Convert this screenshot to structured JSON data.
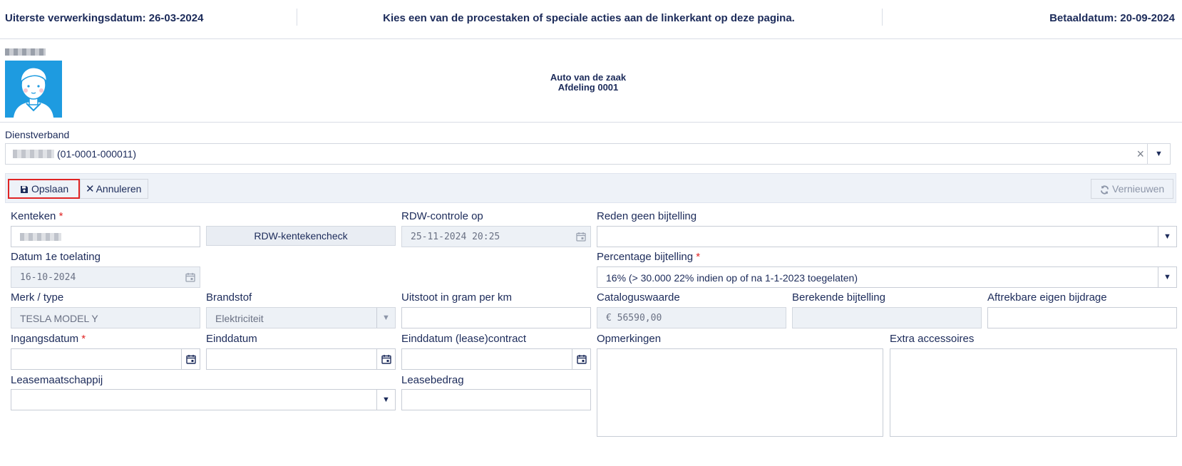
{
  "header": {
    "deadline": "Uiterste verwerkingsdatum: 26-03-2024",
    "instruction": "Kies een van de procestaken of speciale acties aan de linkerkant op deze pagina.",
    "paydate": "Betaaldatum: 20-09-2024"
  },
  "employee": {
    "title": "Auto van de zaak",
    "department": "Afdeling 0001"
  },
  "dienstverband": {
    "label": "Dienstverband",
    "value": "(01-0001-000011)"
  },
  "toolbar": {
    "save_label": "Opslaan",
    "cancel_label": "Annuleren",
    "refresh_label": "Vernieuwen"
  },
  "form": {
    "kenteken": {
      "label": "Kenteken",
      "required": "*"
    },
    "rdw_button": "RDW-kentekencheck",
    "rdw_controle": {
      "label": "RDW-controle op",
      "value": "25-11-2024 20:25"
    },
    "reden_geen_bijtelling": {
      "label": "Reden geen bijtelling",
      "value": ""
    },
    "datum_toelating": {
      "label": "Datum 1e toelating",
      "value": "16-10-2024"
    },
    "percentage_bijtelling": {
      "label": "Percentage bijtelling",
      "required": "*",
      "value": "16% (> 30.000 22% indien op of na 1-1-2023 toegelaten)"
    },
    "merk_type": {
      "label": "Merk / type",
      "value": "TESLA MODEL Y"
    },
    "brandstof": {
      "label": "Brandstof",
      "value": "Elektriciteit"
    },
    "uitstoot": {
      "label": "Uitstoot in gram per km",
      "value": ""
    },
    "cataloguswaarde": {
      "label": "Cataloguswaarde",
      "value": "€ 56590,00"
    },
    "berekende_bijtelling": {
      "label": "Berekende bijtelling",
      "value": ""
    },
    "eigen_bijdrage": {
      "label": "Aftrekbare eigen bijdrage",
      "value": ""
    },
    "ingangsdatum": {
      "label": "Ingangsdatum",
      "required": "*",
      "value": ""
    },
    "einddatum": {
      "label": "Einddatum",
      "value": ""
    },
    "einddatum_contract": {
      "label": "Einddatum (lease)contract",
      "value": ""
    },
    "opmerkingen": {
      "label": "Opmerkingen"
    },
    "extra_accessoires": {
      "label": "Extra accessoires"
    },
    "leasemaatschappij": {
      "label": "Leasemaatschappij",
      "value": ""
    },
    "leasebedrag": {
      "label": "Leasebedrag",
      "value": ""
    }
  },
  "colors": {
    "text": "#1c2b5a",
    "required": "#e02424",
    "avatar_bg": "#1e9be0",
    "toolbar_bg": "#eef2f8",
    "readonly_bg": "#edf1f6"
  },
  "icons": [
    "floppy-disk-icon",
    "close-icon",
    "refresh-icon",
    "calendar-icon",
    "chevron-down-icon",
    "avatar"
  ]
}
